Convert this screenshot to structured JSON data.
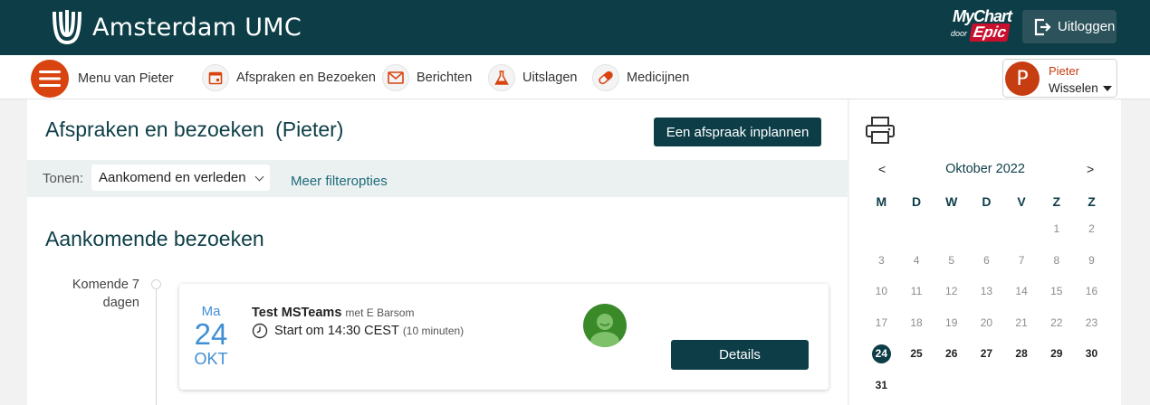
{
  "header": {
    "brand_name": "Amsterdam UMC",
    "mychart_word": "MyChart",
    "mychart_by": "door",
    "mychart_epic": "Epic",
    "logout_label": "Uitloggen"
  },
  "nav": {
    "menu_label": "Menu van Pieter",
    "items": [
      {
        "label": "Afspraken en Bezoeken",
        "icon": "calendar-icon"
      },
      {
        "label": "Berichten",
        "icon": "envelope-icon"
      },
      {
        "label": "Uitslagen",
        "icon": "flask-icon"
      },
      {
        "label": "Medicijnen",
        "icon": "pill-icon"
      }
    ],
    "profile": {
      "initial": "P",
      "name": "Pieter",
      "switch_label": "Wisselen"
    }
  },
  "main": {
    "title": "Afspraken en bezoeken",
    "title_suffix": "(Pieter)",
    "schedule_button": "Een afspraak inplannen",
    "filter": {
      "label": "Tonen:",
      "selected": "Aankomend en verleden",
      "more_link": "Meer filteropties"
    },
    "section_title": "Aankomende bezoeken",
    "timeline_label": "Komende 7 dagen",
    "appointment": {
      "day_name": "Ma",
      "day_num": "24",
      "month": "OKT",
      "title": "Test MSTeams",
      "with": "met E Barsom",
      "time": "Start om 14:30 CEST",
      "duration": "(10 minuten)",
      "details_button": "Details"
    }
  },
  "calendar": {
    "month_label": "Oktober 2022",
    "prev": "<",
    "next": ">",
    "weekdays": [
      "M",
      "D",
      "W",
      "D",
      "V",
      "Z",
      "Z"
    ],
    "leading_blanks": 5,
    "days_in_month": 31,
    "today": 24,
    "colors": {
      "accent": "#0d3e47",
      "brand": "#d8430f",
      "date": "#3f8fd5"
    }
  }
}
